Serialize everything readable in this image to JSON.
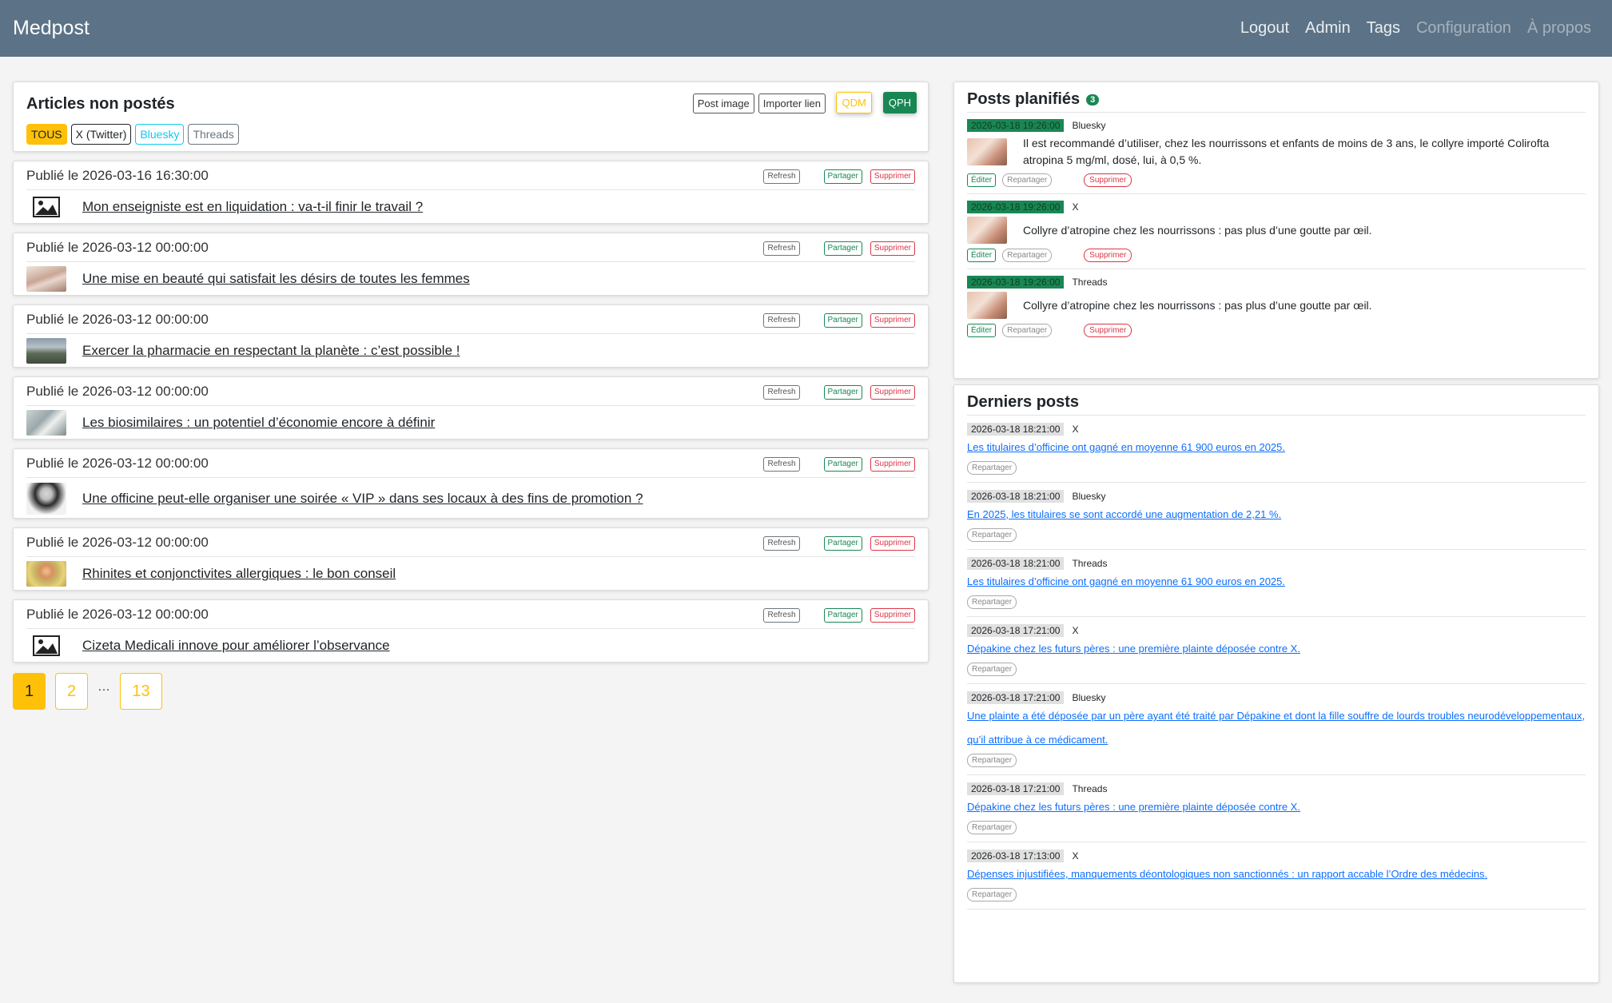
{
  "nav": {
    "brand": "Medpost",
    "links": [
      "Logout",
      "Admin",
      "Tags",
      "Configuration",
      "À propos"
    ]
  },
  "unposted": {
    "title": "Articles non postés",
    "post_image": "Post image",
    "import_link": "Importer lien",
    "qdm": "QDM",
    "qph": "QPH",
    "filters": [
      "TOUS",
      "X (Twitter)",
      "Bluesky",
      "Threads"
    ],
    "btn_refresh": "Refresh",
    "btn_share": "Partager",
    "btn_delete": "Supprimer",
    "articles": [
      {
        "date": "Publié le 2026-03-16 16:30:00",
        "title": "Mon enseigniste est en liquidation : va-t-il finir le travail ?",
        "thumb": "image-placeholder-icon"
      },
      {
        "date": "Publié le 2026-03-12 00:00:00",
        "title": "Une mise en beauté qui satisfait les désirs de toutes les femmes",
        "thumb": "photo"
      },
      {
        "date": "Publié le 2026-03-12 00:00:00",
        "title": "Exercer la pharmacie en respectant la planète : c’est possible !",
        "thumb": "photo"
      },
      {
        "date": "Publié le 2026-03-12 00:00:00",
        "title": "Les biosimilaires : un potentiel d’économie encore à définir",
        "thumb": "photo"
      },
      {
        "date": "Publié le 2026-03-12 00:00:00",
        "title": "Une officine peut-elle organiser une soirée « VIP » dans ses locaux à des fins de promotion ?",
        "thumb": "photo"
      },
      {
        "date": "Publié le 2026-03-12 00:00:00",
        "title": "Rhinites et conjonctivites allergiques : le bon conseil",
        "thumb": "photo"
      },
      {
        "date": "Publié le 2026-03-12 00:00:00",
        "title": "Cizeta Medicali innove pour améliorer l’observance",
        "thumb": "image-placeholder-icon"
      }
    ],
    "pagination": [
      "1",
      "2",
      "…",
      "13"
    ]
  },
  "scheduled": {
    "title": "Posts planifiés",
    "count": "3",
    "btn_edit": "Éditer",
    "btn_repost": "Repartager",
    "btn_delete": "Supprimer",
    "items": [
      {
        "date": "2026-03-18 19:26:00",
        "network": "Bluesky",
        "text": "Il est recommandé d’utiliser, chez les nourrissons et enfants de moins de 3 ans, le collyre importé Colirofta atropina 5 mg/ml, dosé, lui, à 0,5 %."
      },
      {
        "date": "2026-03-18 19:26:00",
        "network": "X",
        "text": "Collyre d’atropine chez les nourrissons : pas plus d’une goutte par œil."
      },
      {
        "date": "2026-03-18 19:26:00",
        "network": "Threads",
        "text": "Collyre d’atropine chez les nourrissons : pas plus d’une goutte par œil."
      }
    ]
  },
  "recent": {
    "title": "Derniers posts",
    "btn_repost": "Repartager",
    "items": [
      {
        "date": "2026-03-18 18:21:00",
        "network": "X",
        "text": "Les titulaires d’officine ont gagné en moyenne 61 900 euros en 2025."
      },
      {
        "date": "2026-03-18 18:21:00",
        "network": "Bluesky",
        "text": "En 2025, les titulaires se sont accordé une augmentation de 2,21 %."
      },
      {
        "date": "2026-03-18 18:21:00",
        "network": "Threads",
        "text": "Les titulaires d’officine ont gagné en moyenne 61 900 euros en 2025."
      },
      {
        "date": "2026-03-18 17:21:00",
        "network": "X",
        "text": "Dépakine chez les futurs pères : une première plainte déposée contre X."
      },
      {
        "date": "2026-03-18 17:21:00",
        "network": "Bluesky",
        "text": "Une plainte a été déposée par un père ayant été traité par Dépakine et dont la fille souffre de lourds troubles neurodéveloppementaux, qu’il attribue à ce médicament."
      },
      {
        "date": "2026-03-18 17:21:00",
        "network": "Threads",
        "text": "Dépakine chez les futurs pères : une première plainte déposée contre X."
      },
      {
        "date": "2026-03-18 17:13:00",
        "network": "X",
        "text": "Dépenses injustifiées, manquements déontologiques non sanctionnés : un rapport accable l’Ordre des médecins."
      }
    ]
  },
  "colors": {
    "navbar": "#5c7387",
    "warning": "#ffc107",
    "success": "#198754",
    "danger": "#dc3545",
    "link": "#0d6efd",
    "info": "#0dcaf0"
  }
}
